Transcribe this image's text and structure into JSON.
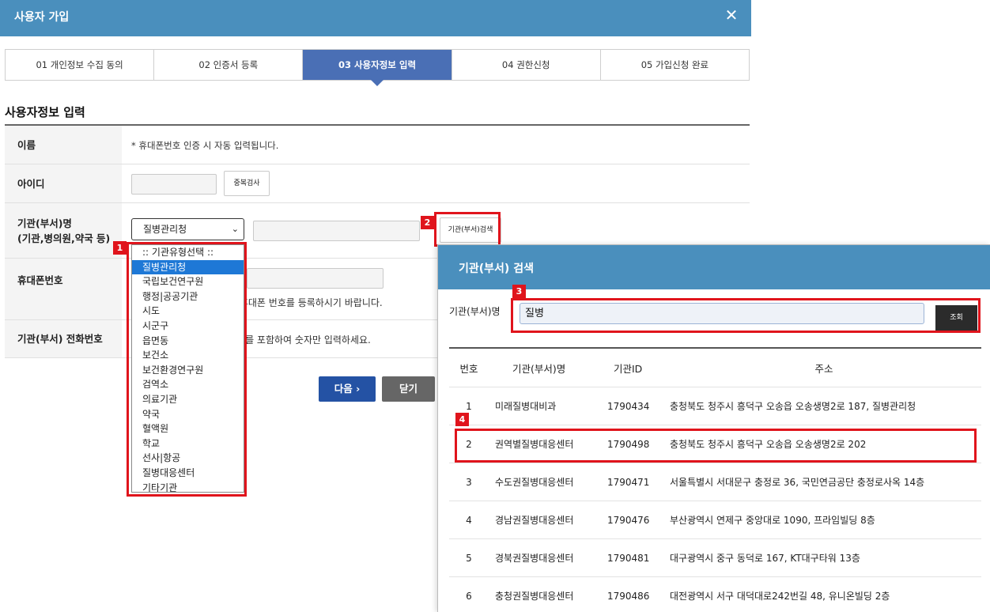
{
  "modal": {
    "title": "사용자 가입",
    "close_icon": "close-icon"
  },
  "steps": [
    {
      "label": "01 개인정보 수집 동의"
    },
    {
      "label": "02 인증서 등록"
    },
    {
      "label": "03 사용자정보 입력",
      "active": true
    },
    {
      "label": "04 권한신청"
    },
    {
      "label": "05 가입신청 완료"
    }
  ],
  "section_title": "사용자정보 입력",
  "form": {
    "name_label": "이름",
    "name_hint": "* 휴대폰번호 인증 시 자동 입력됩니다.",
    "id_label": "아이디",
    "id_value": "",
    "dup_check_label": "중복검사",
    "org_label_line1": "기관(부서)명",
    "org_label_line2": "(기관,병의원,약국 등)",
    "org_type_selected": "질병관리청",
    "org_name_value": "",
    "org_search_label": "기관(부서)검색",
    "phone_label": "휴대폰번호",
    "phone_value": "",
    "phone_hint_visible": "인 휴대폰 번호를 등록하시기 바랍니다.",
    "tel_label": "기관(부서) 전화번호",
    "tel_hint_visible": "번호를 포함하여 숫자만 입력하세요."
  },
  "org_type_options": [
    ":: 기관유형선택 ::",
    "질병관리청",
    "국립보건연구원",
    "행정|공공기관",
    "시도",
    "시군구",
    "읍면동",
    "보건소",
    "보건환경연구원",
    "검역소",
    "의료기관",
    "약국",
    "혈액원",
    "학교",
    "선사|항공",
    "질병대응센터",
    "기타기관"
  ],
  "org_type_selected_index": 1,
  "buttons": {
    "next_label": "다음 ›",
    "close_label": "닫기"
  },
  "callouts": [
    "1",
    "2",
    "3",
    "4"
  ],
  "popup": {
    "title": "기관(부서) 검색",
    "search_label": "기관(부서)명",
    "search_value": "질병",
    "search_button": "조회",
    "columns": [
      "번호",
      "기관(부서)명",
      "기관ID",
      "주소"
    ],
    "rows": [
      {
        "no": "1",
        "name": "미래질병대비과",
        "id": "1790434",
        "address": "충청북도 청주시 흥덕구 오송읍 오송생명2로 187, 질병관리청"
      },
      {
        "no": "2",
        "name": "권역별질병대응센터",
        "id": "1790498",
        "address": "충청북도 청주시 흥덕구 오송읍 오송생명2로 202"
      },
      {
        "no": "3",
        "name": "수도권질병대응센터",
        "id": "1790471",
        "address": "서울특별시 서대문구 충정로 36, 국민연금공단 충정로사옥 14층"
      },
      {
        "no": "4",
        "name": "경남권질병대응센터",
        "id": "1790476",
        "address": "부산광역시 연제구 중앙대로 1090, 프라임빌딩 8층"
      },
      {
        "no": "5",
        "name": "경북권질병대응센터",
        "id": "1790481",
        "address": "대구광역시 중구 동덕로 167, KT대구타워 13층"
      },
      {
        "no": "6",
        "name": "충청권질병대응센터",
        "id": "1790486",
        "address": "대전광역시 서구 대덕대로242번길 48, 유니온빌딩 2층"
      }
    ]
  }
}
